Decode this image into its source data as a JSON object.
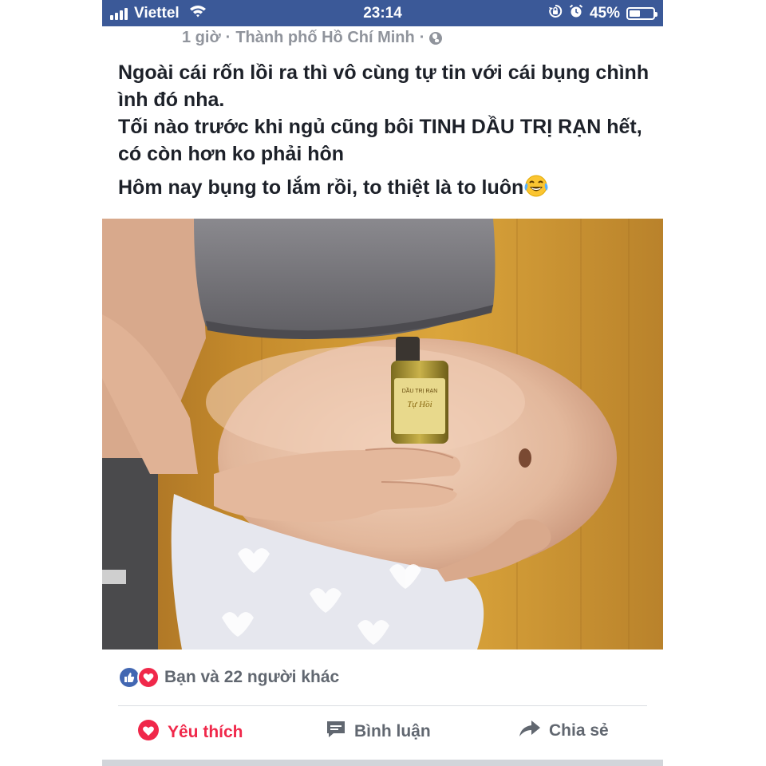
{
  "status_bar": {
    "carrier": "Viettel",
    "time": "23:14",
    "battery_percent_label": "45%",
    "battery_level": 0.45,
    "background_color": "#3b5998"
  },
  "post": {
    "meta": {
      "time_ago": "1 giờ",
      "separator": "·",
      "location": "Thành phố Hồ Chí Minh",
      "privacy_icon": "globe-icon"
    },
    "text": {
      "line1": "Ngoài cái rốn lồi ra thì vô cùng tự tin với cái bụng chình ình đó nha.",
      "line2": "Tối nào trước khi ngủ cũng bôi TINH DẦU TRỊ RẠN hết, có còn hơn ko phải hôn",
      "line3": "Hôm nay bụng to lắm rồi, to thiệt là to luôn",
      "emoji_icon": "laughing-tears-emoji"
    },
    "photo": {
      "bottle_label_line1": "DẦU TRỊ RẠN",
      "bottle_label_line2": "Tự Hồi"
    },
    "reactions": {
      "icons": [
        "like-icon",
        "love-icon"
      ],
      "summary": "Bạn và 22 người khác"
    },
    "actions": {
      "like_label": "Yêu thích",
      "comment_label": "Bình luận",
      "share_label": "Chia sẻ",
      "like_active_color": "#f0284a",
      "inactive_color": "#616770"
    }
  }
}
